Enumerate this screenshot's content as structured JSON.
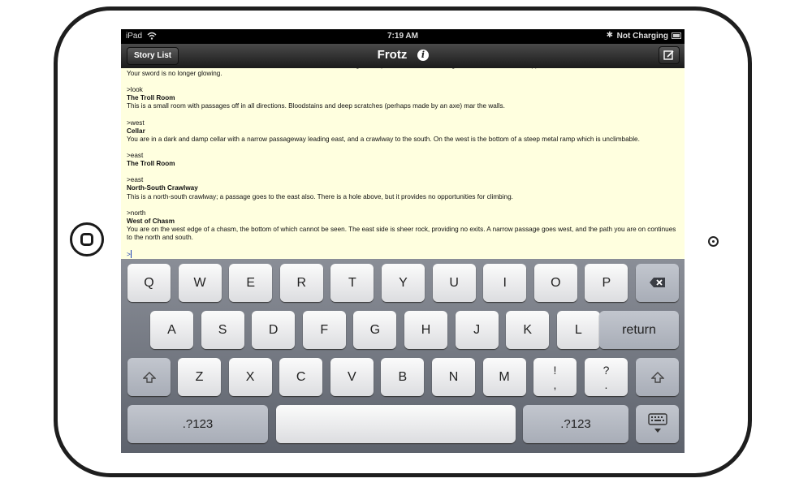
{
  "status_bar": {
    "carrier": "iPad",
    "time": "7:19 AM",
    "bluetooth": "✱",
    "charging": "Not Charging"
  },
  "nav": {
    "story_list_label": "Story List",
    "title": "Frotz",
    "info_icon": "i"
  },
  "story": {
    "lines": [
      {
        "text": "Almost as soon as the troll breathes his last breath, a cloud of sinister black fog envelops him, and when the fog lifts, the carcass has disappeared.",
        "bold": false
      },
      {
        "text": "Your sword is no longer glowing.",
        "bold": false
      },
      {
        "text": "",
        "bold": false
      },
      {
        "text": ">look",
        "bold": false
      },
      {
        "text": "The Troll Room",
        "bold": true
      },
      {
        "text": "This is a small room with passages off in all directions. Bloodstains and deep scratches (perhaps made by an axe) mar the walls.",
        "bold": false
      },
      {
        "text": "",
        "bold": false
      },
      {
        "text": ">west",
        "bold": false
      },
      {
        "text": "Cellar",
        "bold": true
      },
      {
        "text": "You are in a dark and damp cellar with a narrow passageway leading east, and a crawlway to the south.  On the west is the bottom of a steep metal ramp which is unclimbable.",
        "bold": false
      },
      {
        "text": "",
        "bold": false
      },
      {
        "text": ">east",
        "bold": false
      },
      {
        "text": "The Troll Room",
        "bold": true
      },
      {
        "text": "",
        "bold": false
      },
      {
        "text": ">east",
        "bold": false
      },
      {
        "text": "North-South Crawlway",
        "bold": true
      },
      {
        "text": "This is a north-south crawlway; a passage goes to the east also. There is a hole above, but it provides no opportunities for climbing.",
        "bold": false
      },
      {
        "text": "",
        "bold": false
      },
      {
        "text": ">north",
        "bold": false
      },
      {
        "text": "West of Chasm",
        "bold": true
      },
      {
        "text": "You are on the west edge of a chasm, the bottom of which cannot be seen. The east side is sheer rock, providing no exits.  A narrow passage goes west, and the path you are on continues",
        "bold": false
      },
      {
        "text": "to the north and south.",
        "bold": false
      },
      {
        "text": "",
        "bold": false
      }
    ],
    "prompt": ">"
  },
  "keyboard": {
    "row1": [
      "Q",
      "W",
      "E",
      "R",
      "T",
      "Y",
      "U",
      "I",
      "O",
      "P"
    ],
    "row2": [
      "A",
      "S",
      "D",
      "F",
      "G",
      "H",
      "J",
      "K",
      "L"
    ],
    "row3": [
      "Z",
      "X",
      "C",
      "V",
      "B",
      "N",
      "M"
    ],
    "return_label": "return",
    "num_label": ".?123",
    "excl_top": "!",
    "excl_bottom": ",",
    "quest_top": "?",
    "quest_bottom": "."
  }
}
